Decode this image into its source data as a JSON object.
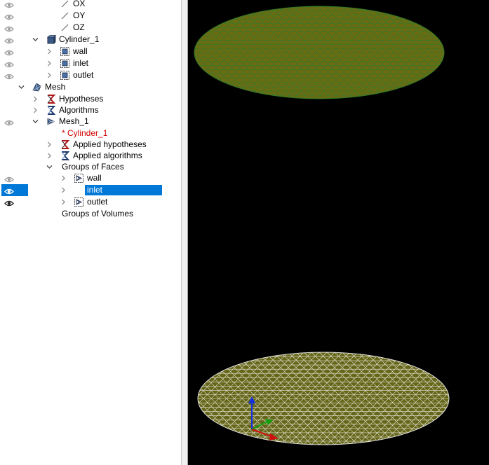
{
  "tree": {
    "items": [
      {
        "label": "OX",
        "icon": "axis-line-icon",
        "eye": "hidden"
      },
      {
        "label": "OY",
        "icon": "axis-line-icon",
        "eye": "hidden"
      },
      {
        "label": "OZ",
        "icon": "axis-line-icon",
        "eye": "hidden"
      },
      {
        "label": "Cylinder_1",
        "icon": "solid-cube-icon",
        "eye": "hidden",
        "expander": "expanded"
      },
      {
        "label": "wall",
        "icon": "face-group-icon",
        "eye": "hidden",
        "expander": "collapsed"
      },
      {
        "label": "inlet",
        "icon": "face-group-icon",
        "eye": "hidden",
        "expander": "collapsed"
      },
      {
        "label": "outlet",
        "icon": "face-group-icon",
        "eye": "hidden",
        "expander": "collapsed"
      },
      {
        "label": "Mesh",
        "icon": "mesh-module-icon",
        "expander": "expanded"
      },
      {
        "label": "Hypotheses",
        "icon": "hypotheses-icon",
        "expander": "collapsed"
      },
      {
        "label": "Algorithms",
        "icon": "algorithms-icon",
        "expander": "collapsed"
      },
      {
        "label": "Mesh_1",
        "icon": "mesh-object-icon",
        "eye": "hidden",
        "expander": "expanded"
      },
      {
        "label": "* Cylinder_1",
        "icon": "",
        "text_color": "#d40000"
      },
      {
        "label": "Applied hypotheses",
        "icon": "hypotheses-icon",
        "expander": "collapsed"
      },
      {
        "label": "Applied algorithms",
        "icon": "algorithms-icon",
        "expander": "collapsed"
      },
      {
        "label": "Groups of Faces",
        "icon": "",
        "expander": "expanded"
      },
      {
        "label": "wall",
        "icon": "mesh-group-icon",
        "eye": "hidden",
        "expander": "collapsed"
      },
      {
        "label": "inlet",
        "icon": "mesh-group-icon",
        "eye": "selected",
        "expander": "collapsed",
        "selected": true
      },
      {
        "label": "outlet",
        "icon": "mesh-group-icon",
        "eye": "visible",
        "expander": "collapsed"
      },
      {
        "label": "Groups of Volumes",
        "icon": ""
      }
    ]
  },
  "viewport": {
    "background": "#000000",
    "top_disk_color": "#6b6b12",
    "top_disk_edge_color": "#2e7d2e",
    "bottom_disk_color": "#66661a",
    "bottom_disk_edge_color": "#ffffff",
    "triad_icon": "axis-triad-icon",
    "axis_colors": {
      "x": "#d01010",
      "y": "#10a010",
      "z": "#1030e0"
    }
  },
  "colors": {
    "selection": "#0078d7"
  }
}
